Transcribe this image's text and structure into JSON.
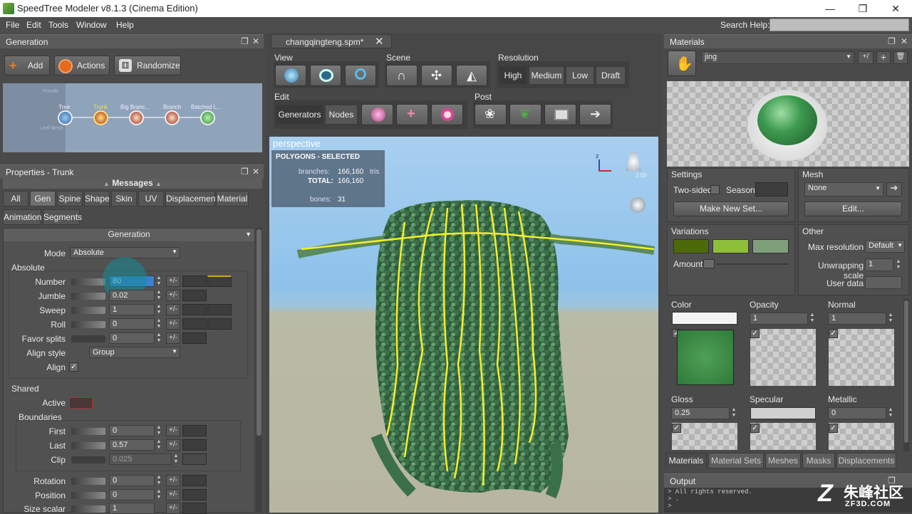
{
  "app": {
    "title": "SpeedTree Modeler v8.1.3 (Cinema Edition)"
  },
  "window_controls": {
    "minimize": "—",
    "restore": "❐",
    "close": "✕"
  },
  "menu": {
    "items": [
      "File",
      "Edit",
      "Tools",
      "Window",
      "Help"
    ],
    "search_label": "Search Help:"
  },
  "generation": {
    "title": "Generation",
    "add": "Add",
    "actions": "Actions",
    "randomize": "Randomize",
    "nodes": [
      "Tree",
      "Trunk",
      "Big Branc...",
      "Branch",
      "Batched L..."
    ],
    "faint_nodes": [
      "Fronds",
      "Leaf Mesh"
    ]
  },
  "properties": {
    "title": "Properties - Trunk",
    "messages": "Messages",
    "tabs": [
      "All",
      "Gen",
      "Spine",
      "Shape",
      "Skin",
      "UV",
      "Displacement",
      "Material",
      "Animation",
      "Segments"
    ],
    "section": "Generation",
    "mode_label": "Mode",
    "mode_value": "Absolute",
    "absolute_label": "Absolute",
    "rows": [
      {
        "label": "Number",
        "value": "80"
      },
      {
        "label": "Jumble",
        "value": "0.02"
      },
      {
        "label": "Sweep",
        "value": "1"
      },
      {
        "label": "Roll",
        "value": "0"
      },
      {
        "label": "Favor splits",
        "value": "0"
      }
    ],
    "align_style_label": "Align style",
    "align_style_value": "Group",
    "align_label": "Align",
    "shared_label": "Shared",
    "active_label": "Active",
    "boundaries_label": "Boundaries",
    "boundary_rows": [
      {
        "label": "First",
        "value": "0"
      },
      {
        "label": "Last",
        "value": "0.57"
      },
      {
        "label": "Clip",
        "value": "0.025"
      }
    ],
    "lower_rows": [
      {
        "label": "Rotation",
        "value": "0"
      },
      {
        "label": "Position",
        "value": "0"
      },
      {
        "label": "Size scalar",
        "value": "1"
      }
    ],
    "plusminus": "+/-"
  },
  "viewport": {
    "tab": "changqingteng.spm*",
    "view_label": "View",
    "scene_label": "Scene",
    "resolution_label": "Resolution",
    "resolutions": [
      "High",
      "Medium",
      "Low",
      "Draft"
    ],
    "edit_label": "Edit",
    "generators": "Generators",
    "nodes": "Nodes",
    "post_label": "Post",
    "camera": "perspective",
    "stats_title": "POLYGONS - SELECTED",
    "branches_label": "branches:",
    "branches_value": "166,160",
    "tris": "tris",
    "total_label": "TOTAL:",
    "total_value": "166,160",
    "bones_label": "bones:",
    "bones_value": "31",
    "axis_z": "z",
    "light_value": "2.00"
  },
  "materials": {
    "title": "Materials",
    "name": "jing",
    "plusminus": "+/",
    "settings_label": "Settings",
    "two_sided": "Two-sided",
    "season": "Season",
    "make_new_set": "Make New Set...",
    "mesh_label": "Mesh",
    "mesh_value": "None",
    "edit": "Edit...",
    "variations_label": "Variations",
    "amount_label": "Amount",
    "other_label": "Other",
    "max_res_label": "Max resolution",
    "max_res_value": "Default",
    "unwrap_label": "Unwrapping scale",
    "unwrap_value": "1",
    "user_data_label": "User data",
    "color_label": "Color",
    "opacity_label": "Opacity",
    "opacity_value": "1",
    "normal_label": "Normal",
    "normal_value": "1",
    "gloss_label": "Gloss",
    "gloss_value": "0.25",
    "specular_label": "Specular",
    "metallic_label": "Metallic",
    "metallic_value": "0",
    "bottom_tabs": [
      "Materials",
      "Material Sets",
      "Meshes",
      "Masks",
      "Displacements"
    ],
    "variation_colors": [
      "#4d6a0a",
      "#8fbf3a",
      "#7f9f7b"
    ]
  },
  "output": {
    "title": "Output",
    "lines": [
      "> All rights reserved.",
      "> .",
      ">"
    ],
    "watermark": "朱峰社区",
    "watermark_url": "ZF3D.COM"
  }
}
